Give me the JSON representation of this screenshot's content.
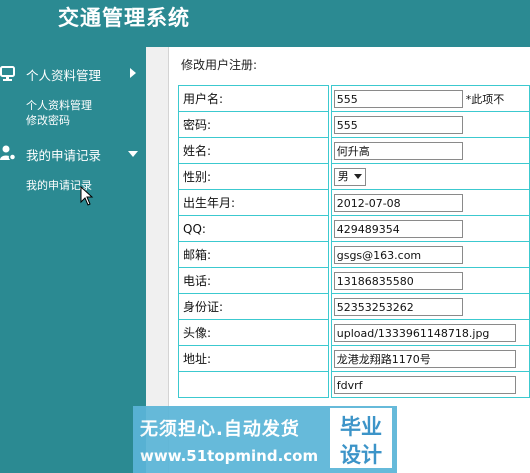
{
  "app": {
    "title": "交通管理系统"
  },
  "sidebar": {
    "groups": [
      {
        "label": "个人资料管理",
        "icon": "monitor-icon",
        "items": [
          "个人资料管理",
          "修改密码"
        ]
      },
      {
        "label": "我的申请记录",
        "icon": "user-gear-icon",
        "items": [
          "我的申请记录"
        ]
      }
    ]
  },
  "main": {
    "heading": "修改用户注册:",
    "required_note": "*此项不",
    "fields": [
      {
        "label": "用户名:",
        "value": "555"
      },
      {
        "label": "密码:",
        "value": "555"
      },
      {
        "label": "姓名:",
        "value": "何升高"
      },
      {
        "label": "性别:",
        "value": "男"
      },
      {
        "label": "出生年月:",
        "value": "2012-07-08"
      },
      {
        "label": "QQ:",
        "value": "429489354"
      },
      {
        "label": "邮箱:",
        "value": "gsgs@163.com"
      },
      {
        "label": "电话:",
        "value": "13186835580"
      },
      {
        "label": "身份证:",
        "value": "52353253262"
      },
      {
        "label": "头像:",
        "value": "upload/1333961148718.jpg"
      },
      {
        "label": "地址:",
        "value": "龙港龙翔路1170号"
      },
      {
        "label": "",
        "value": "fdvrf"
      }
    ]
  },
  "banner": {
    "line1": "无须担心.自动发货",
    "line2": "www.51topmind.com",
    "box_line1": "毕业",
    "box_line2": "设计"
  },
  "colors": {
    "header_bg": "#2b8a92",
    "border_accent": "#3cc9cf",
    "banner_bg": "#5bb5d8"
  }
}
